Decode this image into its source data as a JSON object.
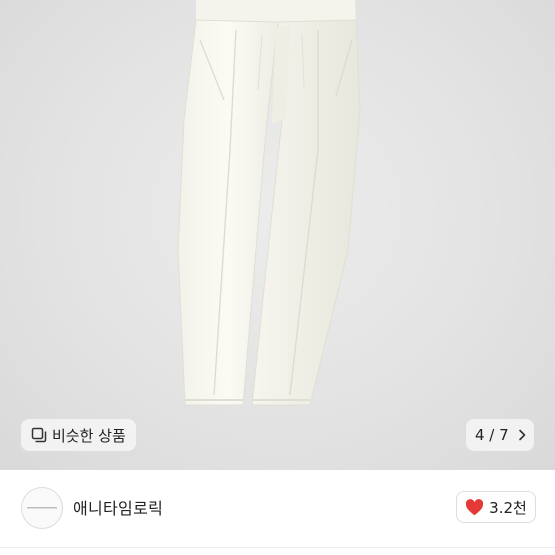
{
  "product": {
    "image_alt": "white pleated trousers",
    "similar_button_label": "비슷한 상품",
    "similar_icon": "similar-items-icon",
    "image_counter": "4 / 7",
    "next_icon": "chevron-right-icon"
  },
  "seller": {
    "name": "애니타임로릭",
    "avatar_icon": "seller-logo",
    "likes_count": "3.2천",
    "like_icon": "heart-icon",
    "like_color": "#e53935"
  }
}
